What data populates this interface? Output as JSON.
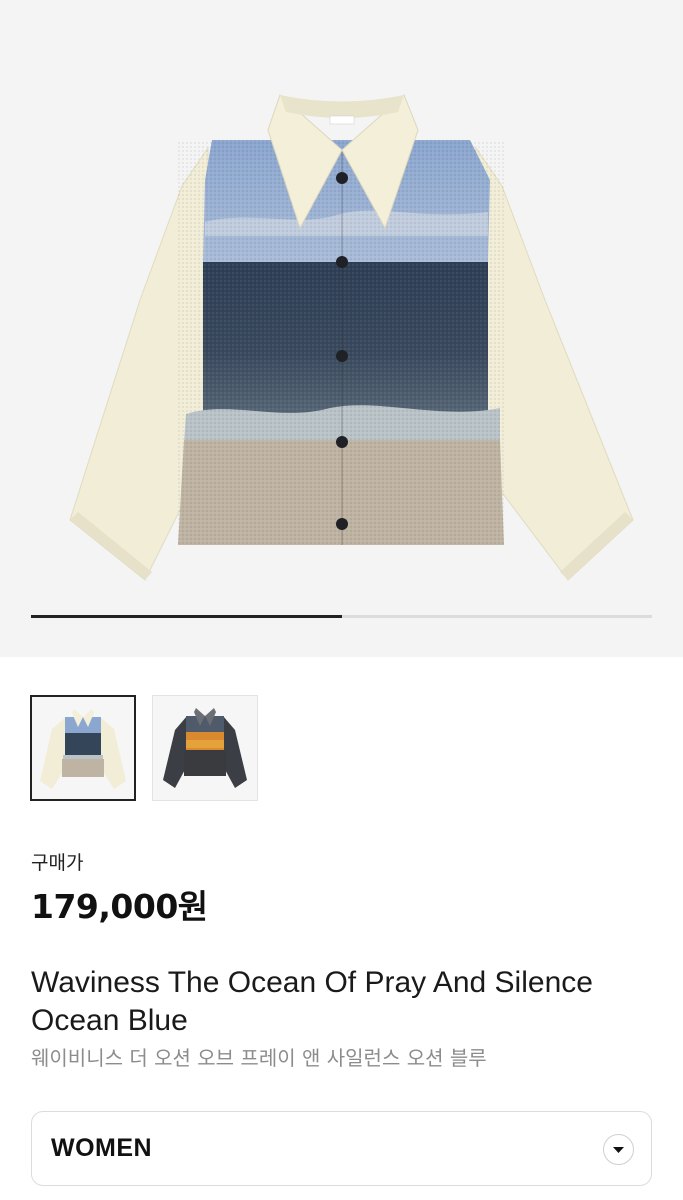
{
  "gallery": {
    "progress_fraction": 0.5,
    "thumbnails": [
      {
        "name": "ocean-blue",
        "selected": true
      },
      {
        "name": "sunset",
        "selected": false
      }
    ]
  },
  "product": {
    "price_label": "구매가",
    "price": "179,000원",
    "title": "Waviness The Ocean Of Pray And Silence Ocean Blue",
    "subtitle": "웨이비니스 더 오션 오브 프레이 앤 사일런스 오션 블루"
  },
  "category_dropdown": {
    "value": "WOMEN",
    "icon": "chevron-down-icon"
  }
}
